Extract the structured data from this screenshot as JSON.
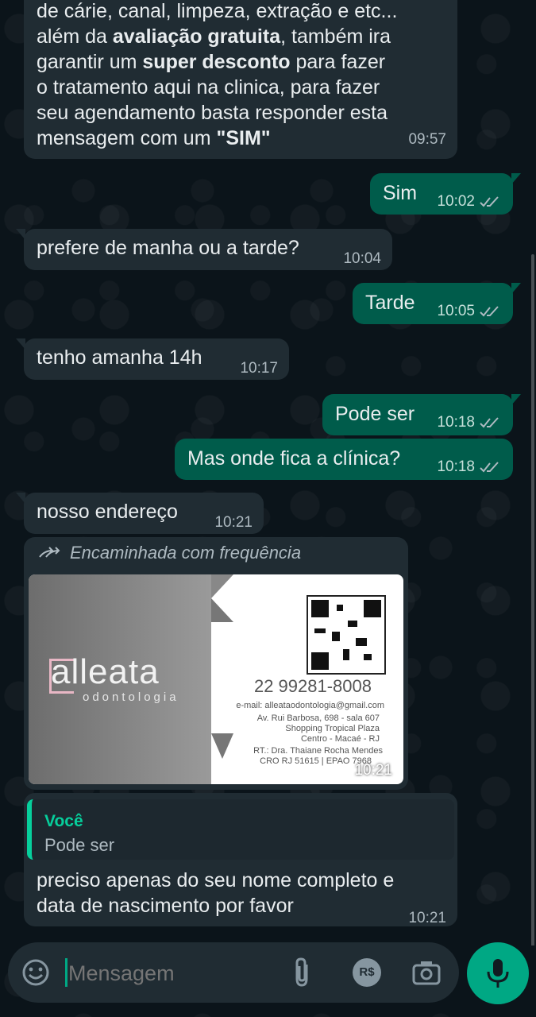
{
  "messages": {
    "m1": {
      "line0": "de cárie, canal, limpeza, extração e etc...",
      "line1_pre": "além da ",
      "line1_bold": "avaliação gratuita",
      "line1_post": ", também ira",
      "line2_pre": "garantir um ",
      "line2_bold": "super desconto",
      "line2_post": " para fazer",
      "line3": "o tratamento aqui na clinica, para fazer",
      "line4": "seu agendamento basta responder esta",
      "line5_pre": "mensagem com um ",
      "line5_bold": "\"SIM\"",
      "time": "09:57"
    },
    "m2": {
      "text": "Sim",
      "time": "10:02"
    },
    "m3": {
      "text": "prefere de manha ou a tarde?",
      "time": "10:04"
    },
    "m4": {
      "text": "Tarde",
      "time": "10:05"
    },
    "m5": {
      "text": "tenho amanha 14h",
      "time": "10:17"
    },
    "m6": {
      "text": "Pode ser",
      "time": "10:18"
    },
    "m7": {
      "text": "Mas onde fica a clínica?",
      "time": "10:18"
    },
    "m8": {
      "text": "nosso endereço",
      "time": "10:21"
    },
    "m9": {
      "forwarded": "Encaminhada com frequência",
      "time": "10:21",
      "card": {
        "brand": "alleata",
        "brand_sub": "odontologia",
        "phone": "22 99281-8008",
        "email": "e-mail: alleataodontologia@gmail.com",
        "address1": "Av. Rui Barbosa, 698 - sala 607",
        "address2": "Shopping Tropical Plaza",
        "address3": "Centro - Macaé - RJ",
        "rt": "RT.: Dra. Thaiane Rocha Mendes",
        "cro": "CRO RJ 51615 | EPAO 7968"
      }
    },
    "m10": {
      "quote_author": "Você",
      "quote_text": "Pode ser",
      "line1": "preciso apenas do seu nome completo e",
      "line2": "data de nascimento por favor",
      "time": "10:21"
    }
  },
  "composer": {
    "placeholder": "Mensagem",
    "emoji_icon": "emoji-icon",
    "attach_icon": "paperclip-icon",
    "payment_icon": "payment-icon",
    "payment_label": "R$",
    "camera_icon": "camera-icon",
    "mic_icon": "microphone-icon"
  },
  "colors": {
    "background": "#0b141a",
    "incoming": "#202c33",
    "outgoing": "#005c4b",
    "accent": "#00a884",
    "quote_author": "#06cf9c"
  }
}
